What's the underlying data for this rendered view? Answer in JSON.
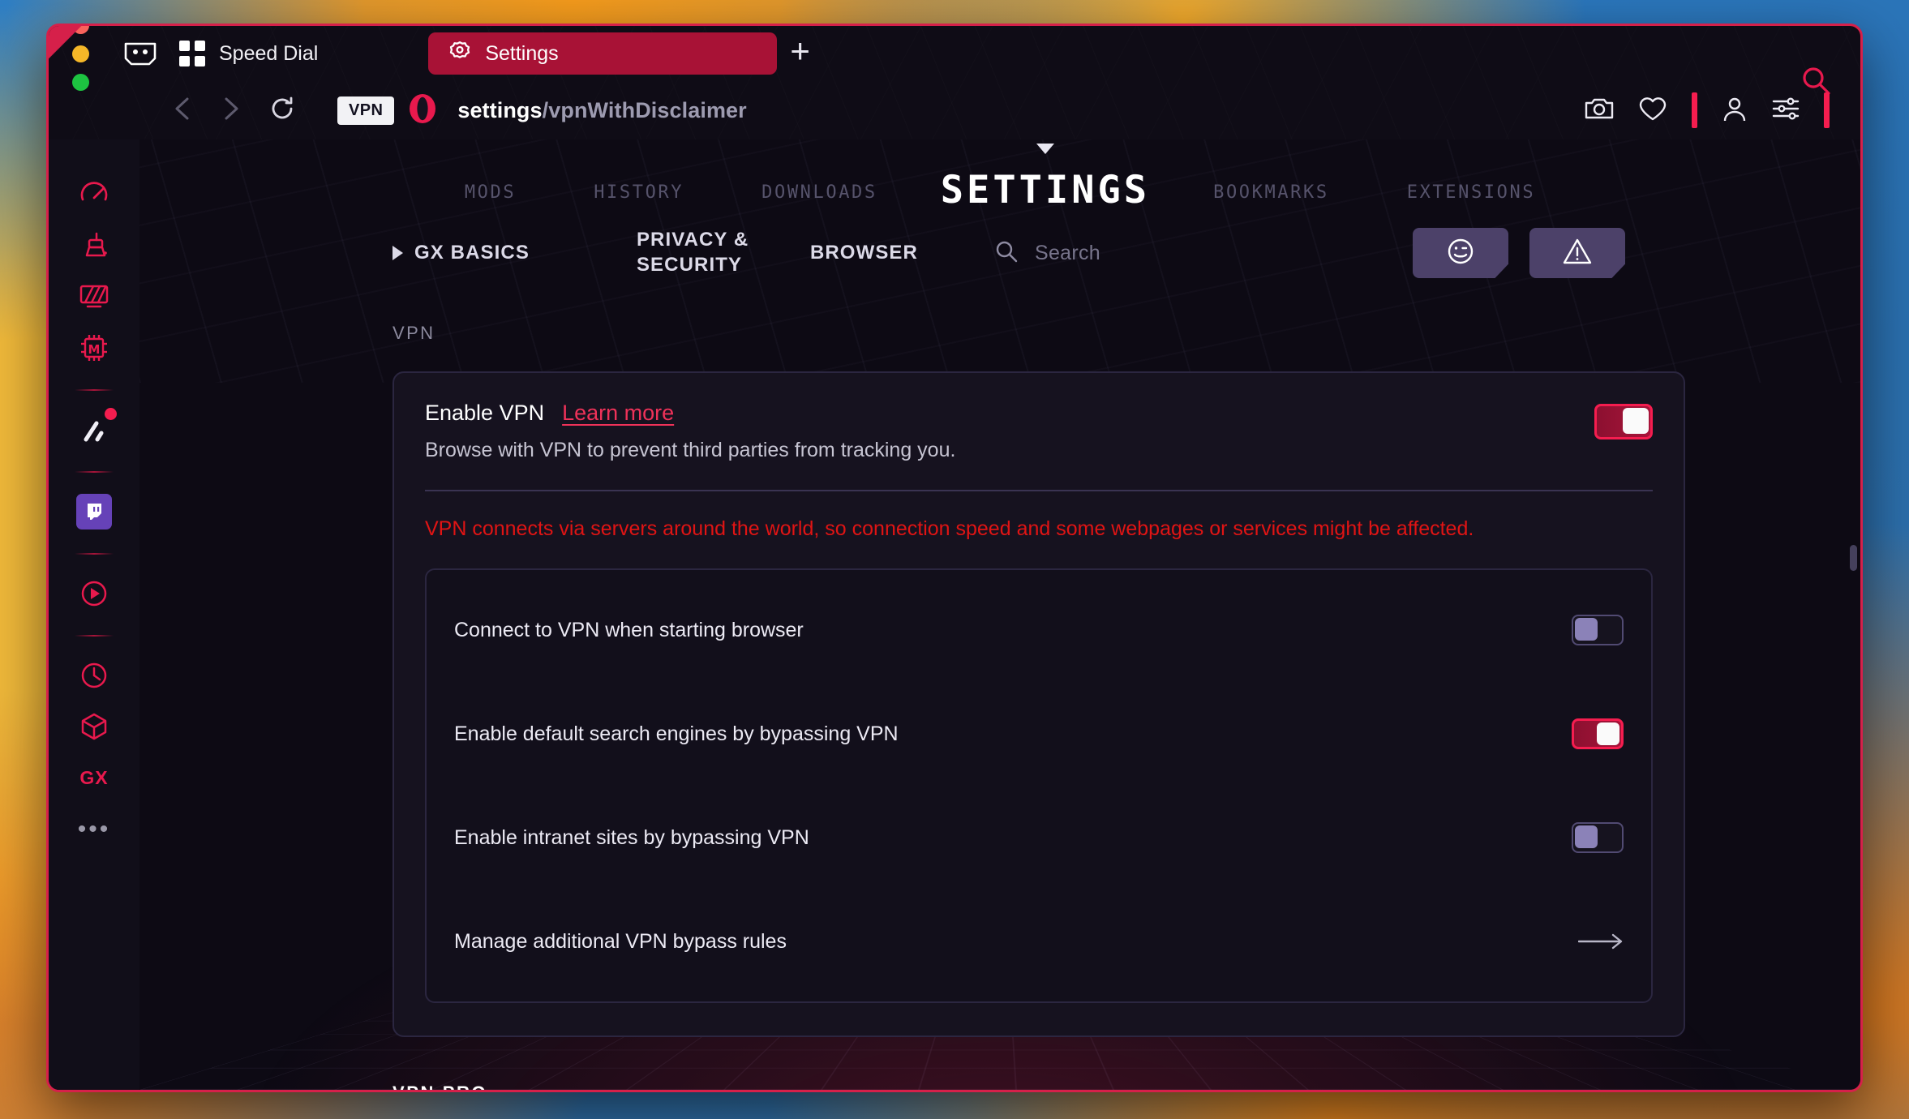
{
  "window": {
    "traffic_lights": [
      "close",
      "minimize",
      "zoom"
    ],
    "accent_color": "#d6204a"
  },
  "tabbar": {
    "gamepad_icon": "gamepad-icon",
    "grid_icon": "grid-icon",
    "speed_dial_label": "Speed Dial",
    "settings_tab": {
      "icon": "gear-icon",
      "label": "Settings"
    },
    "new_tab_label": "+",
    "search_icon": "search-icon"
  },
  "addressbar": {
    "back_icon": "chevron-left-icon",
    "forward_icon": "chevron-right-icon",
    "reload_icon": "reload-icon",
    "vpn_badge": "VPN",
    "opera_logo": "opera-logo-icon",
    "url_host": "settings",
    "url_path": "/vpnWithDisclaimer",
    "actions": [
      "camera-icon",
      "heart-icon",
      "person-icon",
      "sliders-icon"
    ]
  },
  "sidebar": {
    "items": [
      {
        "name": "speedometer-icon"
      },
      {
        "name": "cleaner-icon"
      },
      {
        "name": "monitor-icon"
      },
      {
        "name": "mods-chip-icon"
      },
      {
        "name": "gx-control-icon",
        "badge": true
      },
      {
        "name": "twitch-icon"
      },
      {
        "name": "play-circle-icon"
      },
      {
        "name": "clock-icon"
      },
      {
        "name": "cube-icon"
      },
      {
        "name": "gx-label",
        "label": "GX"
      },
      {
        "name": "more-icon",
        "label": "•••"
      }
    ]
  },
  "topnav": {
    "items": [
      {
        "label": "MODS",
        "active": false
      },
      {
        "label": "HISTORY",
        "active": false
      },
      {
        "label": "DOWNLOADS",
        "active": false
      },
      {
        "label": "SETTINGS",
        "active": true
      },
      {
        "label": "BOOKMARKS",
        "active": false
      },
      {
        "label": "EXTENSIONS",
        "active": false
      }
    ]
  },
  "subnav": {
    "gx_basics": "GX BASICS",
    "privacy_security": "PRIVACY & SECURITY",
    "browser": "BROWSER",
    "search_placeholder": "Search",
    "search_icon": "search-icon",
    "emoji_button": "smiley-icon",
    "warning_button": "warning-triangle-icon"
  },
  "content": {
    "section_label": "VPN",
    "vpn": {
      "title": "Enable VPN",
      "learn_more": "Learn more",
      "description": "Browse with VPN to prevent third parties from tracking you.",
      "toggle_state": "on",
      "disclaimer": "VPN connects via servers around the world, so connection speed and some webpages or services might be affected.",
      "sub_rows": [
        {
          "label": "Connect to VPN when starting browser",
          "control": "toggle",
          "state": "off"
        },
        {
          "label": "Enable default search engines by bypassing VPN",
          "control": "toggle",
          "state": "on"
        },
        {
          "label": "Enable intranet sites by bypassing VPN",
          "control": "toggle",
          "state": "off"
        },
        {
          "label": "Manage additional VPN bypass rules",
          "control": "arrow",
          "state": ""
        }
      ]
    },
    "vpn_pro_label": "VPN PRO"
  },
  "colors": {
    "accent_red": "#e8194d",
    "tab_red": "#a81236",
    "purple_button": "#4c4169",
    "disclaimer_red": "#e01414",
    "twitch_purple": "#6642b8"
  }
}
